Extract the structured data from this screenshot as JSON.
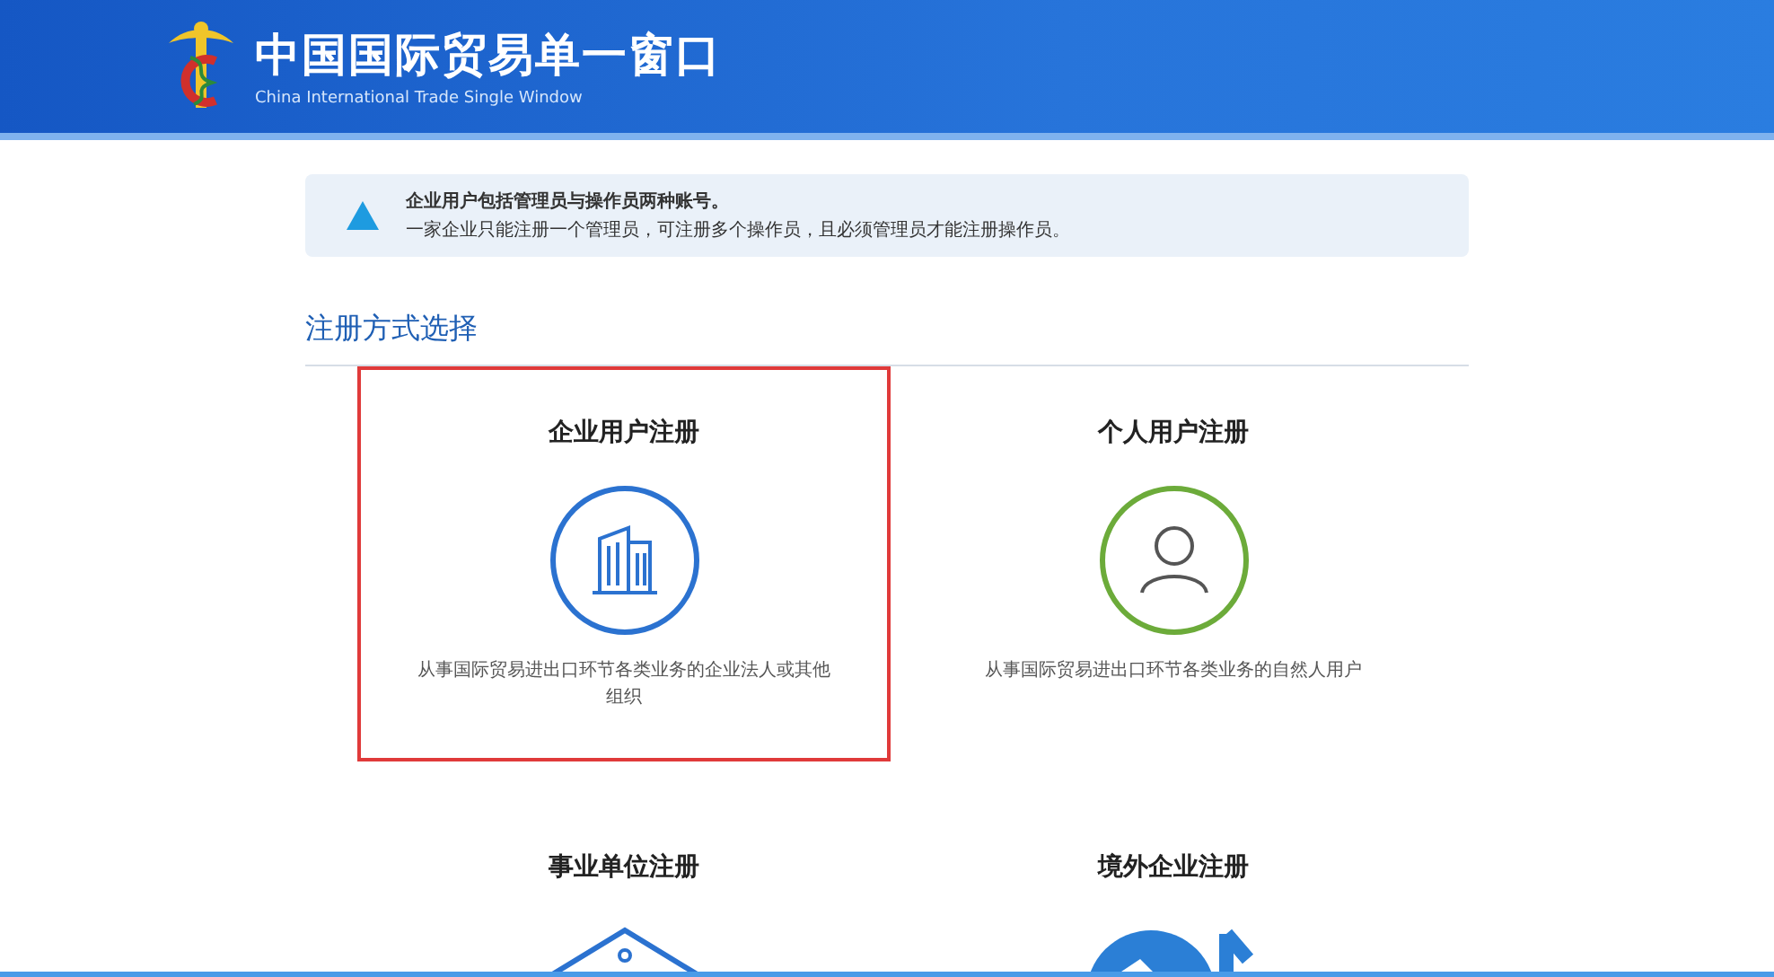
{
  "header": {
    "title": "中国国际贸易单一窗口",
    "subtitle": "China International Trade Single Window"
  },
  "notice": {
    "heading": "企业用户包括管理员与操作员两种账号。",
    "text": "一家企业只能注册一个管理员，可注册多个操作员，且必须管理员才能注册操作员。"
  },
  "section": {
    "title": "注册方式选择"
  },
  "cards": [
    {
      "kind": "building",
      "title": "企业用户注册",
      "description": "从事国际贸易进出口环节各类业务的企业法人或其他组织",
      "selected": true
    },
    {
      "kind": "person",
      "title": "个人用户注册",
      "description": "从事国际贸易进出口环节各类业务的自然人用户",
      "selected": false
    },
    {
      "kind": "house",
      "title": "事业单位注册",
      "selected": false
    },
    {
      "kind": "globe",
      "title": "境外企业注册",
      "selected": false
    }
  ]
}
